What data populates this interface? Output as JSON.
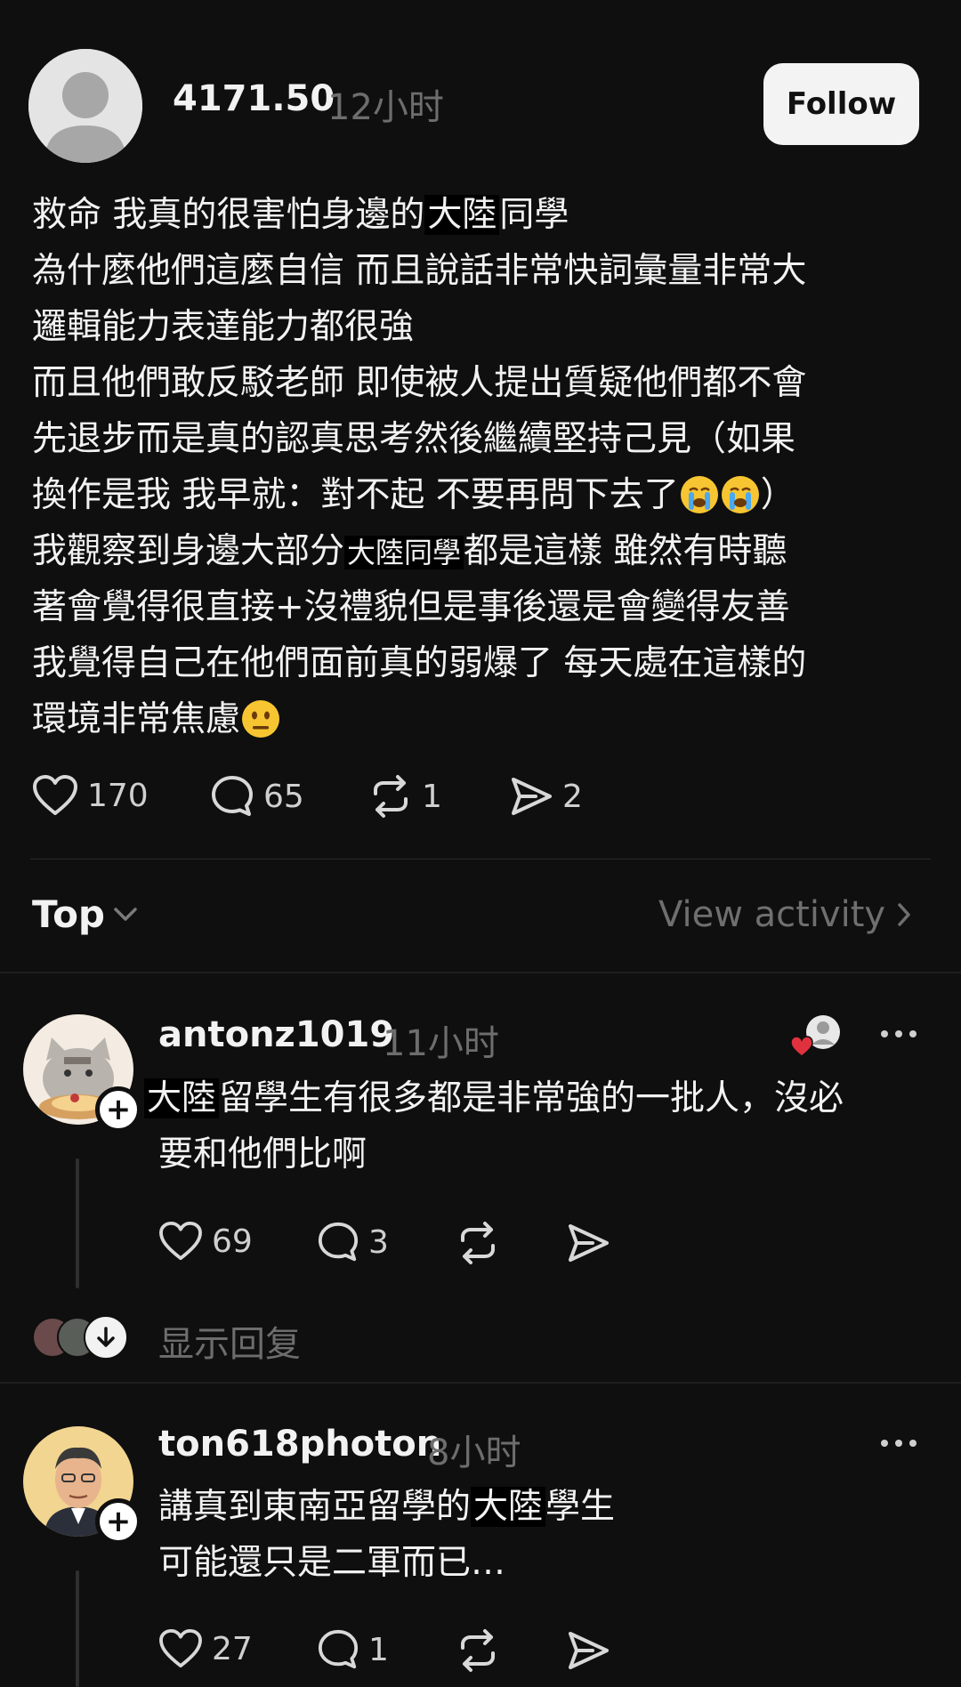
{
  "post": {
    "author": "4171.50",
    "time": "12小时",
    "follow_label": "Follow",
    "lines": [
      {
        "before": "救命 我真的很害怕身邊的",
        "highlight": "大陸",
        "after": "同學"
      },
      {
        "before": "為什麼他們這麼自信 而且說話非常快詞彙量非常大",
        "highlight": "",
        "after": ""
      },
      {
        "before": "邏輯能力表達能力都很強",
        "highlight": "",
        "after": ""
      },
      {
        "before": "而且他們敢反駁老師 即使被人提出質疑他們都不會",
        "highlight": "",
        "after": ""
      },
      {
        "before": "先退步而是真的認真思考然後繼續堅持己見（如果",
        "highlight": "",
        "after": ""
      },
      {
        "before": "換作是我 我早就：對不起 不要再問下去了",
        "highlight": "",
        "after": "）"
      },
      {
        "before": "我觀察到身邊大部分",
        "highlight": "大陸同學",
        "after": "都是這樣 雖然有時聽"
      },
      {
        "before": "著會覺得很直接+沒禮貌但是事後還是會變得友善",
        "highlight": "",
        "after": ""
      },
      {
        "before": "我覺得自己在他們面前真的弱爆了 每天處在這樣的",
        "highlight": "",
        "after": ""
      },
      {
        "before": "環境非常焦慮",
        "highlight": "",
        "after": ""
      }
    ],
    "likes": "170",
    "comments": "65",
    "reposts": "1",
    "shares": "2"
  },
  "sort": {
    "label": "Top",
    "view_activity": "View activity"
  },
  "replies": [
    {
      "author": "antonz1019",
      "time": "11小时",
      "lines": [
        {
          "before": "",
          "highlight": "大陸",
          "after": "留學生有很多都是非常強的一批人，沒必"
        },
        {
          "before": "要和他們比啊",
          "highlight": "",
          "after": ""
        }
      ],
      "likes": "69",
      "comments": "3",
      "show_replies": "显示回复"
    },
    {
      "author": "ton618photon",
      "time": "8小时",
      "lines": [
        {
          "before": "講真到東南亞留學的",
          "highlight": "大陸",
          "after": "學生"
        },
        {
          "before": "可能還只是二軍而已…",
          "highlight": "",
          "after": ""
        }
      ],
      "likes": "27",
      "comments": "1"
    }
  ],
  "colors": {
    "background": "#0f0f0f",
    "text": "#f2f2f2",
    "muted": "#6d6d6d",
    "like_red": "#e0313f"
  }
}
